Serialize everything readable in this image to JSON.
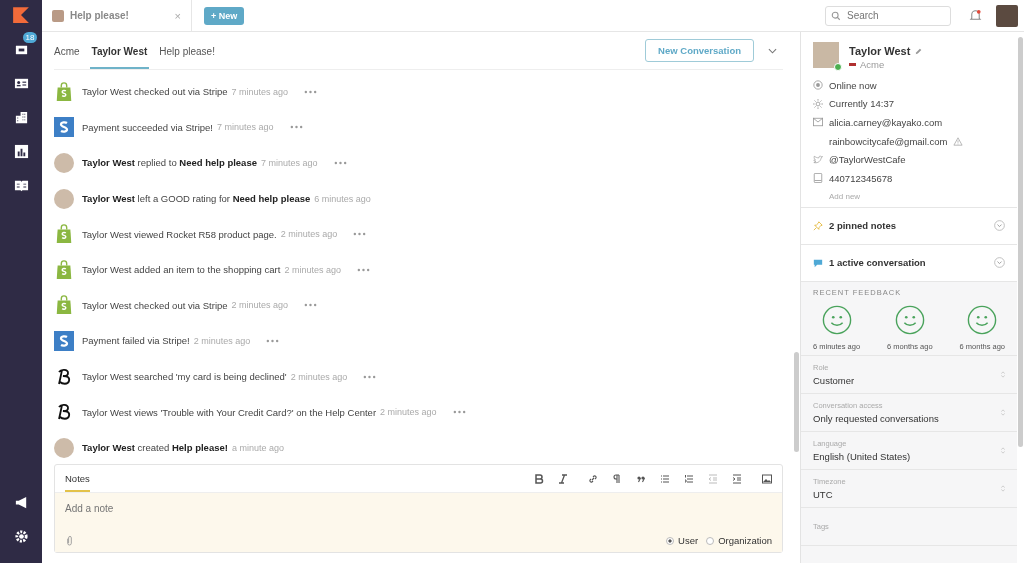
{
  "sidebar": {
    "items": [
      {
        "kind": "logo"
      },
      {
        "kind": "inbox",
        "badge": "18"
      },
      {
        "kind": "contacts"
      },
      {
        "kind": "organizations"
      },
      {
        "kind": "reports"
      },
      {
        "kind": "helpcenter"
      },
      {
        "kind": "spacer"
      },
      {
        "kind": "megaphone"
      },
      {
        "kind": "settings"
      }
    ]
  },
  "tabs": [
    {
      "label": "Help please!",
      "selected": true,
      "close": "×"
    }
  ],
  "new_button": {
    "icon": "+",
    "label": "New"
  },
  "search": {
    "placeholder": "Search"
  },
  "breadcrumbs": [
    {
      "label": "Acme",
      "selected": false
    },
    {
      "label": "Taylor West",
      "selected": true
    },
    {
      "label": "Help please!",
      "selected": false
    }
  ],
  "new_conversation": "New Conversation",
  "timeline": [
    {
      "kind": "shopify",
      "text": "Taylor West checked out via Stripe",
      "time": "7 minutes ago",
      "menu": true
    },
    {
      "kind": "stripe",
      "text": "Payment succeeded via Stripe!",
      "time": "7 minutes ago",
      "menu": true
    },
    {
      "kind": "user",
      "text": "**Taylor West** replied to **Need help please**",
      "time": "7 minutes ago",
      "menu": true
    },
    {
      "kind": "user",
      "text": "**Taylor West** left a GOOD rating for **Need help please**",
      "time": "6 minutes ago",
      "menu": false
    },
    {
      "kind": "shopify",
      "text": "Taylor West viewed Rocket R58 product page.",
      "time": "2 minutes ago",
      "menu": true
    },
    {
      "kind": "shopify",
      "text": "Taylor West added an item to the shopping cart",
      "time": "2 minutes ago",
      "menu": true
    },
    {
      "kind": "shopify",
      "text": "Taylor West checked out via Stripe",
      "time": "2 minutes ago",
      "menu": true
    },
    {
      "kind": "stripe",
      "text": "Payment failed via Stripe!",
      "time": "2 minutes ago",
      "menu": true
    },
    {
      "kind": "helpcenter",
      "text": "Taylor West searched 'my card is being declined'",
      "time": "2 minutes ago",
      "menu": true
    },
    {
      "kind": "helpcenter",
      "text": "Taylor West views 'Trouble with Your Credit Card?' on the Help Center",
      "time": "2 minutes ago",
      "menu": true
    },
    {
      "kind": "user",
      "text": "**Taylor West** created **Help please!**",
      "time": "a minute ago",
      "menu": false
    }
  ],
  "notes": {
    "tab": "Notes",
    "placeholder": "Add a note",
    "toolbar": [
      {
        "kind": "bold"
      },
      {
        "kind": "italic"
      },
      {
        "kind": "link"
      },
      {
        "kind": "paragraph"
      },
      {
        "kind": "quote"
      },
      {
        "kind": "bullets"
      },
      {
        "kind": "numbers"
      },
      {
        "kind": "outdent"
      },
      {
        "kind": "indent"
      },
      {
        "kind": "image"
      }
    ],
    "scope": [
      {
        "label": "User",
        "selected": true
      },
      {
        "label": "Organization",
        "selected": false
      }
    ]
  },
  "profile": {
    "name": "Taylor West",
    "organization": "Acme",
    "online": true,
    "details": [
      {
        "kind": "status",
        "text": "Online now",
        "warning": false
      },
      {
        "kind": "time",
        "text": "Currently 14:37",
        "warning": false
      },
      {
        "kind": "email",
        "text": "alicia.carney@kayako.com",
        "warning": false
      },
      {
        "kind": "email",
        "text": "rainbowcitycafe@gmail.com",
        "warning": true
      },
      {
        "kind": "twitter",
        "text": "@TaylorWestCafe",
        "warning": false
      },
      {
        "kind": "phone",
        "text": "440712345678",
        "warning": false
      }
    ],
    "add_new": "Add new"
  },
  "sections": [
    {
      "kind": "pin",
      "label": "2 pinned notes"
    },
    {
      "kind": "chat",
      "label": "1 active conversation"
    }
  ],
  "feedback": {
    "title": "RECENT FEEDBACK",
    "items": [
      {
        "time": "6 minutes ago"
      },
      {
        "time": "6 months ago"
      },
      {
        "time": "6 months ago"
      }
    ]
  },
  "fields": [
    {
      "label": "Role",
      "value": "Customer"
    },
    {
      "label": "Conversation access",
      "value": "Only requested conversations"
    },
    {
      "label": "Language",
      "value": "English (United States)"
    },
    {
      "label": "Timezone",
      "value": "UTC"
    },
    {
      "label": "Tags"
    }
  ]
}
